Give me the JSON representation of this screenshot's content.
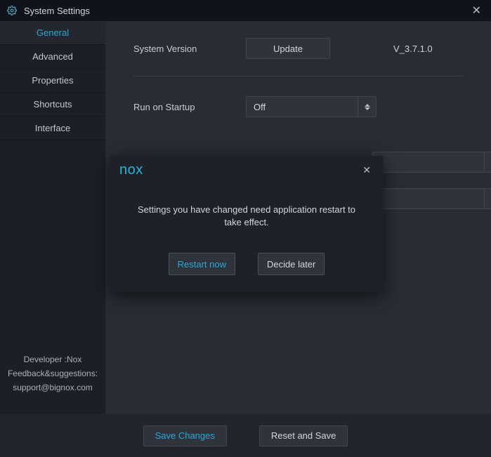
{
  "titlebar": {
    "title": "System Settings"
  },
  "sidebar": {
    "tabs": [
      {
        "label": "General"
      },
      {
        "label": "Advanced"
      },
      {
        "label": "Properties"
      },
      {
        "label": "Shortcuts"
      },
      {
        "label": "Interface"
      }
    ],
    "footer": {
      "line1": "Developer :Nox",
      "line2": "Feedback&suggestions:",
      "line3": "support@bignox.com"
    }
  },
  "content": {
    "version_label": "System Version",
    "update_btn": "Update",
    "version_value": "V_3.7.1.0",
    "startup_label": "Run on Startup",
    "startup_value": "Off"
  },
  "modal": {
    "logo": "nox",
    "message": "Settings you have changed need application restart to take effect.",
    "restart_btn": "Restart now",
    "later_btn": "Decide later"
  },
  "bottom": {
    "save_btn": "Save Changes",
    "reset_btn": "Reset and Save"
  }
}
